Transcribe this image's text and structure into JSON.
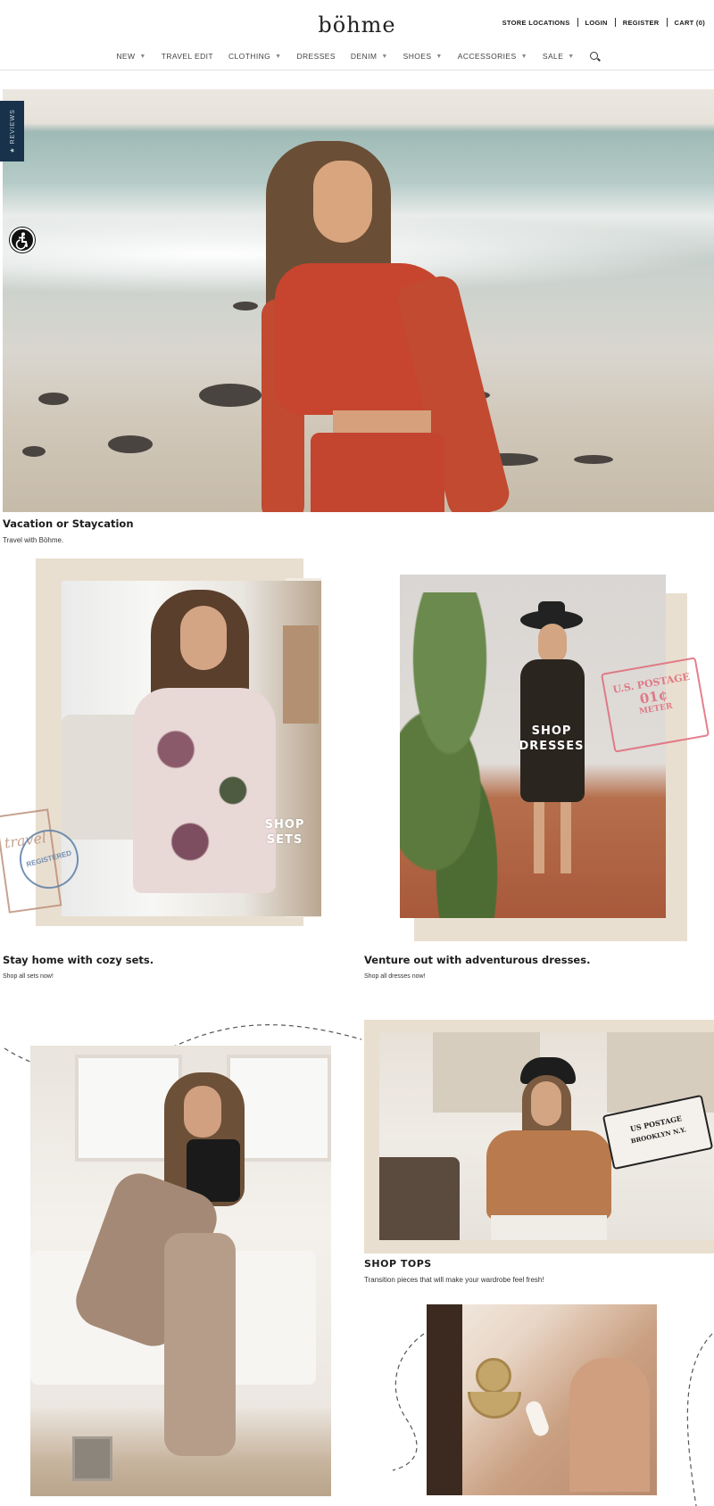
{
  "brand": {
    "logo": "böhme"
  },
  "utility_nav": [
    "STORE LOCATIONS",
    "LOGIN",
    "REGISTER",
    "CART (0)"
  ],
  "main_nav": [
    {
      "label": "NEW",
      "dropdown": true
    },
    {
      "label": "TRAVEL EDIT",
      "dropdown": false
    },
    {
      "label": "CLOTHING",
      "dropdown": true
    },
    {
      "label": "DRESSES",
      "dropdown": false
    },
    {
      "label": "DENIM",
      "dropdown": true
    },
    {
      "label": "SHOES",
      "dropdown": true
    },
    {
      "label": "ACCESSORIES",
      "dropdown": true
    },
    {
      "label": "SALE",
      "dropdown": true
    }
  ],
  "icons": {
    "search": "search-icon",
    "accessibility": "accessibility-icon",
    "caret": "caret-down-icon"
  },
  "reviews_tab": "★ REVIEWS",
  "hero": {
    "title": "Vacation or Staycation",
    "subtitle": "Travel with Böhme."
  },
  "sets": {
    "overlay": [
      "SHOP",
      "SETS"
    ],
    "title": "Stay home with cozy sets.",
    "subtitle": "Shop all sets now!"
  },
  "dresses": {
    "overlay": [
      "SHOP",
      "DRESSES"
    ],
    "title": "Venture out with adventurous dresses.",
    "subtitle": "Shop all dresses now!"
  },
  "tops": {
    "title": "SHOP TOPS",
    "subtitle": "Transition pieces that will make your wardrobe feel fresh!"
  },
  "stamps": {
    "postage": [
      "U.S. POSTAGE",
      "01¢",
      "METER"
    ],
    "registered": [
      "REGISTERED",
      "travel"
    ],
    "postage_tops": [
      "US POSTAGE",
      "BROOKLYN N.Y."
    ]
  },
  "colors": {
    "accent_dark": "#17324a",
    "paper": "#e9dfd0",
    "hero_top": "#c7452e",
    "stamp_red": "#e06a79",
    "stamp_blue": "#5d7fa7"
  }
}
